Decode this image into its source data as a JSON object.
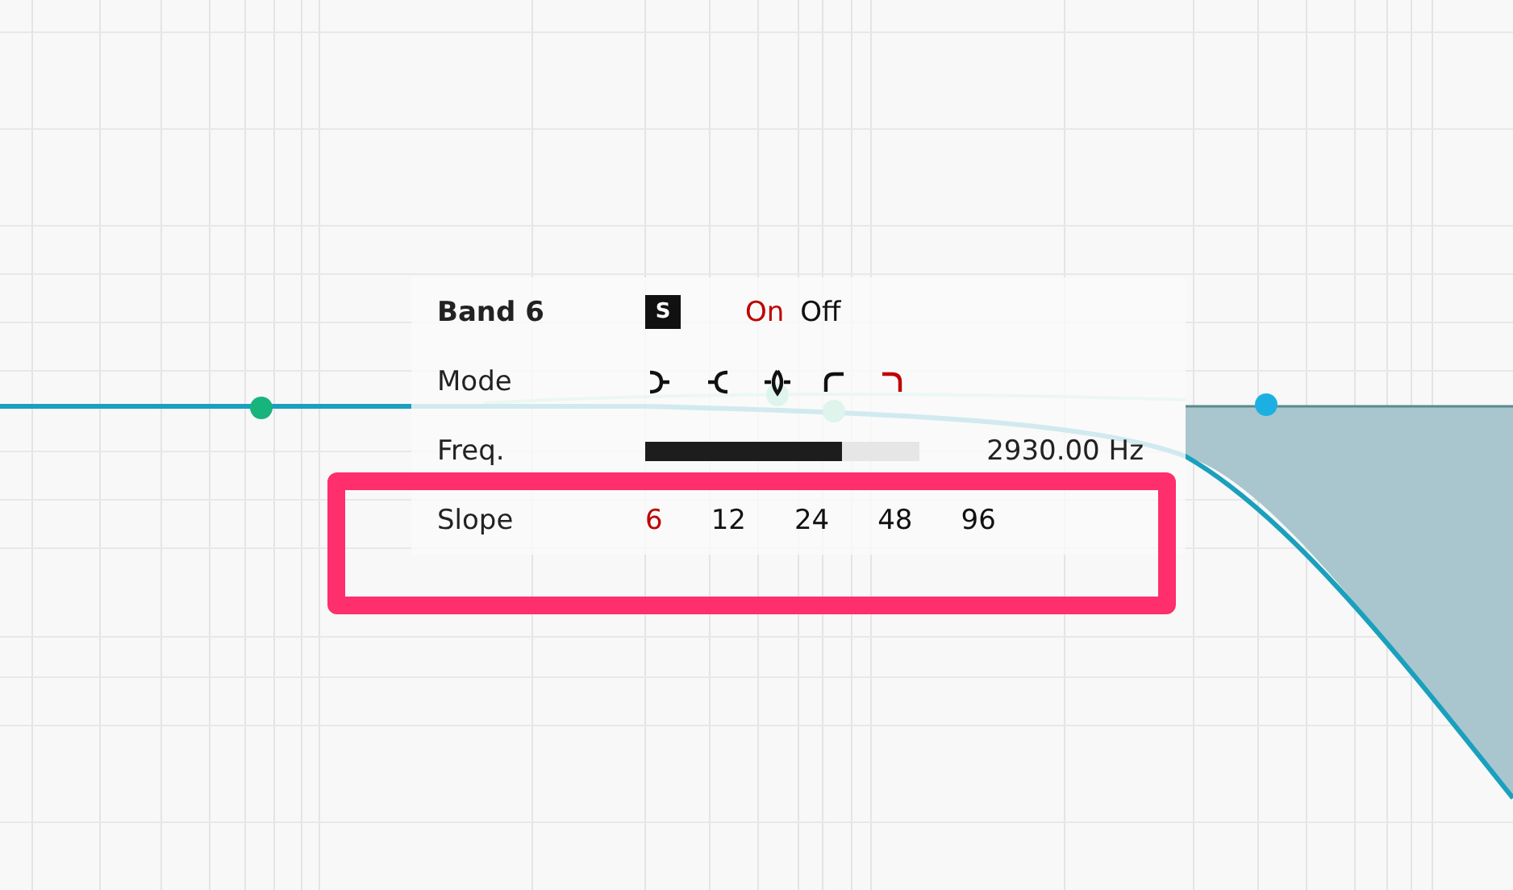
{
  "band": {
    "title": "Band 6",
    "solo": "S",
    "power": [
      {
        "label": "On",
        "selected": true
      },
      {
        "label": "Off",
        "selected": false
      }
    ]
  },
  "mode": {
    "label": "Mode",
    "options": [
      {
        "kind": "low-shelf",
        "selected": false
      },
      {
        "kind": "high-shelf",
        "selected": false
      },
      {
        "kind": "notch",
        "selected": false
      },
      {
        "kind": "high-pass",
        "selected": false
      },
      {
        "kind": "low-pass",
        "selected": true
      }
    ]
  },
  "freq": {
    "label": "Freq.",
    "level": 0.72,
    "value": "2930.00 Hz"
  },
  "slope": {
    "label": "Slope",
    "highlighted": true,
    "options": [
      {
        "label": "6",
        "selected": true
      },
      {
        "label": "12",
        "selected": false
      },
      {
        "label": "24",
        "selected": false
      },
      {
        "label": "48",
        "selected": false
      },
      {
        "label": "96",
        "selected": false
      }
    ]
  }
}
